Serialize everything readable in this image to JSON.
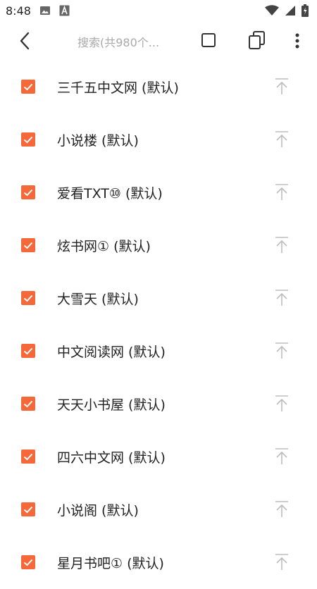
{
  "status_bar": {
    "time": "8:48",
    "icons": [
      "image-icon",
      "font-icon",
      "wifi-icon",
      "signal-icon",
      "battery-icon"
    ]
  },
  "toolbar": {
    "search_placeholder": "搜索(共980个...",
    "icons": [
      "back-arrow-icon",
      "select-all-icon",
      "invert-select-icon",
      "more-vert-icon"
    ]
  },
  "colors": {
    "accent": "#f4683a",
    "text": "#222222",
    "placeholder": "#a9a9a9",
    "top_icon": "#bdbdbd"
  },
  "sources": [
    {
      "label": "三千五中文网 (默认)",
      "checked": true
    },
    {
      "label": "小说楼 (默认)",
      "checked": true
    },
    {
      "label": "爱看TXT⑩ (默认)",
      "checked": true
    },
    {
      "label": "炫书网① (默认)",
      "checked": true
    },
    {
      "label": "大雪天 (默认)",
      "checked": true
    },
    {
      "label": "中文阅读网 (默认)",
      "checked": true
    },
    {
      "label": "天天小书屋 (默认)",
      "checked": true
    },
    {
      "label": "四六中文网 (默认)",
      "checked": true
    },
    {
      "label": "小说阁 (默认)",
      "checked": true
    },
    {
      "label": "星月书吧① (默认)",
      "checked": true
    }
  ]
}
